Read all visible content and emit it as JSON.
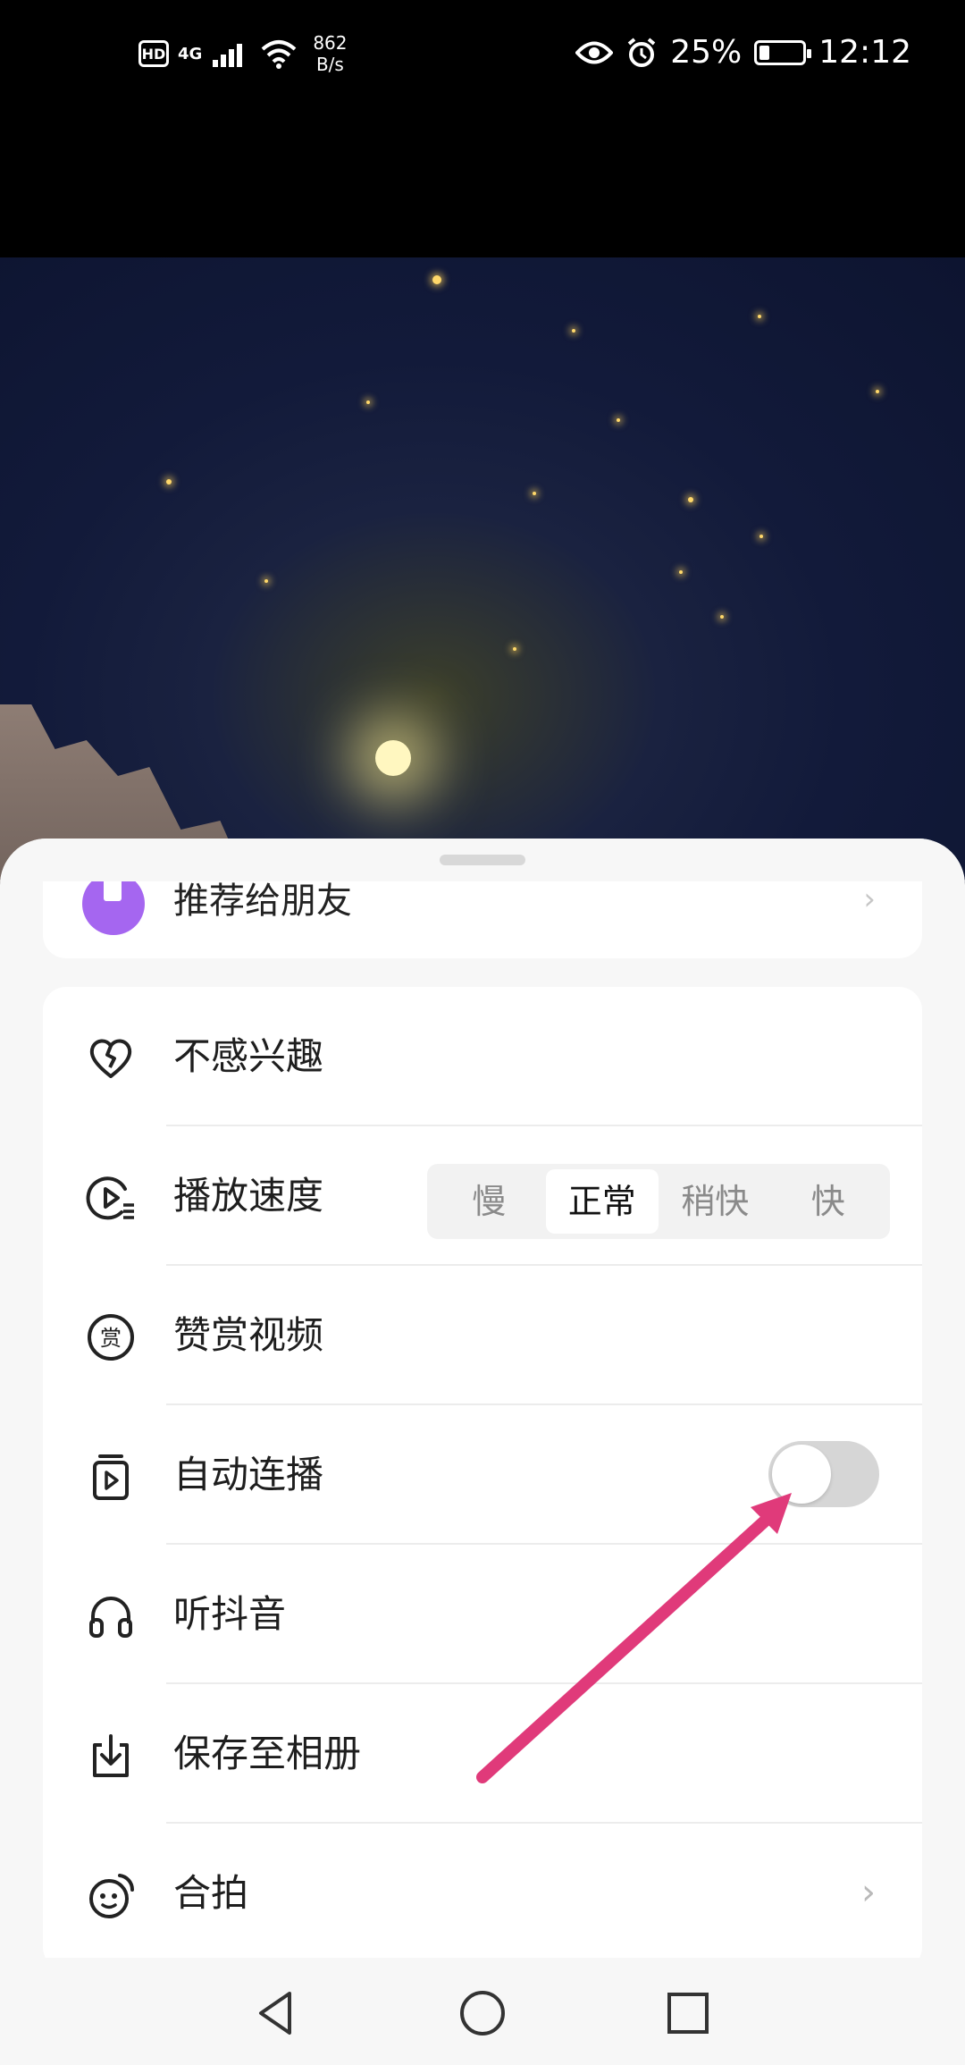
{
  "status_bar": {
    "hd": "HD",
    "network": "4G",
    "net_speed_value": "862",
    "net_speed_unit": "B/s",
    "battery_percent": "25%",
    "battery_level": 0.25,
    "time": "12:12"
  },
  "sheet": {
    "partial_item_label": "推荐给朋友",
    "items": [
      {
        "label": "不感兴趣",
        "icon": "heart-broken-icon"
      },
      {
        "label": "播放速度",
        "icon": "playback-speed-icon"
      },
      {
        "label": "赞赏视频",
        "icon": "reward-icon"
      },
      {
        "label": "自动连播",
        "icon": "autoplay-icon"
      },
      {
        "label": "听抖音",
        "icon": "headphones-icon"
      },
      {
        "label": "保存至相册",
        "icon": "download-icon"
      },
      {
        "label": "合拍",
        "icon": "duet-icon"
      }
    ],
    "speed_options": [
      "慢",
      "正常",
      "稍快",
      "快"
    ],
    "speed_selected": "正常",
    "autoplay_enabled": false
  },
  "colors": {
    "accent_purple": "#a566f0",
    "annotation_arrow": "#e03a7a",
    "toggle_off": "#d6d6d6"
  }
}
